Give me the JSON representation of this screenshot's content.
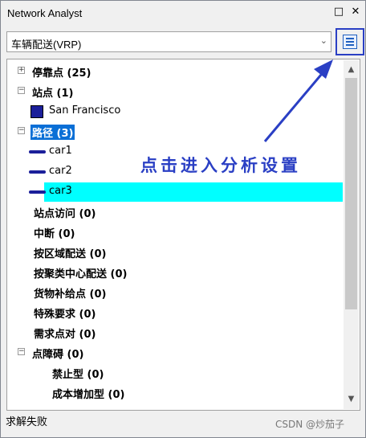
{
  "window": {
    "title": "Network Analyst",
    "pin_icon": "□",
    "close_icon": "✕"
  },
  "combo": {
    "value": "车辆配送(VRP)"
  },
  "props_button": {
    "icon": "properties-icon"
  },
  "tree": {
    "nodes": [
      {
        "label": "停靠点 (25)",
        "expander": "+",
        "bold": true
      },
      {
        "label": "站点 (1)",
        "expander": "−",
        "bold": true
      },
      {
        "label": "San Francisco",
        "bold": false
      },
      {
        "label": "路径 (3)",
        "expander": "−",
        "bold": true,
        "selected": true
      },
      {
        "label": "car1",
        "bold": false
      },
      {
        "label": "car2",
        "bold": false
      },
      {
        "label": "car3",
        "bold": false,
        "highlighted": true
      },
      {
        "label": "站点访问 (0)",
        "bold": true
      },
      {
        "label": "中断 (0)",
        "bold": true
      },
      {
        "label": "按区域配送 (0)",
        "bold": true
      },
      {
        "label": "按聚类中心配送 (0)",
        "bold": true
      },
      {
        "label": "货物补给点 (0)",
        "bold": true
      },
      {
        "label": "特殊要求 (0)",
        "bold": true
      },
      {
        "label": "需求点对 (0)",
        "bold": true
      },
      {
        "label": "点障碍 (0)",
        "expander": "−",
        "bold": true
      },
      {
        "label": "禁止型 (0)",
        "bold": true
      },
      {
        "label": "成本增加型 (0)",
        "bold": true
      }
    ]
  },
  "status": {
    "text": "求解失败"
  },
  "annotation": {
    "text": "点击进入分析设置"
  },
  "watermark": {
    "text": "CSDN @炒茄子"
  },
  "colors": {
    "accent": "#2a3fc4",
    "route": "#1b1f9a",
    "highlight": "#00ffff",
    "selection": "#0a6fd6"
  }
}
